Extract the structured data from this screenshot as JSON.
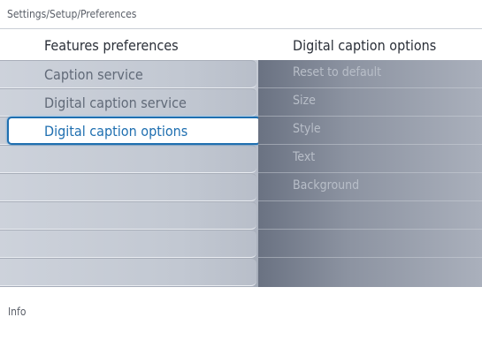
{
  "breadcrumb": "Settings/Setup/Preferences",
  "left_column": {
    "title": "Features preferences",
    "items": [
      {
        "label": "Caption service"
      },
      {
        "label": "Digital caption service"
      },
      {
        "label": "Digital caption options",
        "selected": true
      },
      {
        "label": ""
      },
      {
        "label": ""
      },
      {
        "label": ""
      },
      {
        "label": ""
      },
      {
        "label": ""
      }
    ]
  },
  "right_column": {
    "title": "Digital caption options",
    "items": [
      {
        "label": "Reset to default"
      },
      {
        "label": "Size"
      },
      {
        "label": "Style"
      },
      {
        "label": "Text"
      },
      {
        "label": "Background"
      },
      {
        "label": ""
      },
      {
        "label": ""
      },
      {
        "label": ""
      }
    ]
  },
  "info": {
    "label": "Info"
  },
  "colors": {
    "selection_border": "#1f6fb0",
    "selection_text": "#1f6fb0",
    "left_panel": "#c2c8d2",
    "right_panel": "#8c93a1"
  }
}
